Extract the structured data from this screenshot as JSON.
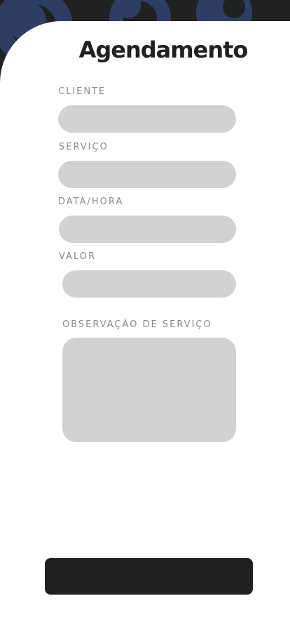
{
  "page": {
    "title": "Agendamento"
  },
  "form": {
    "cliente": {
      "label": "CLIENTE",
      "value": "",
      "placeholder": ""
    },
    "servico": {
      "label": "SERVIÇO",
      "value": "",
      "placeholder": ""
    },
    "data_hora": {
      "label": "DATA/HORA",
      "value": "",
      "placeholder": ""
    },
    "valor": {
      "label": "VALOR",
      "value": "",
      "placeholder": ""
    },
    "observacao": {
      "label": "OBSERVAÇÃO DE SERVIÇO",
      "value": "",
      "placeholder": ""
    }
  },
  "submit_button": {
    "label": ""
  },
  "colors": {
    "background_dark": "#1f2220",
    "decor_circle": "#2e3d63",
    "sheet": "#ffffff",
    "field": "#d3d2d3",
    "label": "#8a8a8a",
    "title": "#1f2220",
    "button": "#1f2220"
  }
}
